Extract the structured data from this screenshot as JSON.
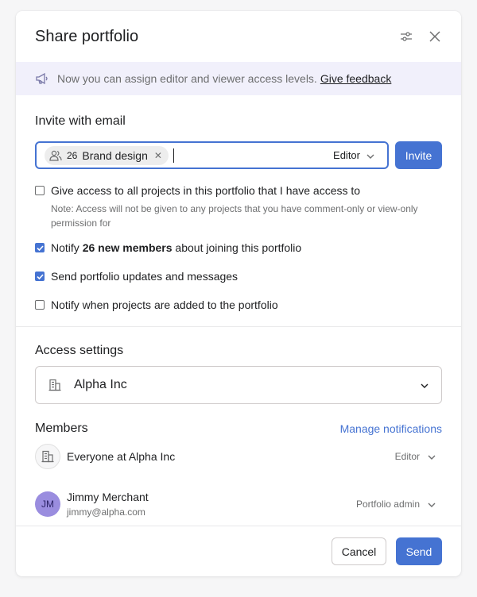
{
  "dialog": {
    "title": "Share portfolio"
  },
  "banner": {
    "message": "Now you can assign editor and viewer access levels.",
    "feedback_link": "Give feedback"
  },
  "invite": {
    "section_title": "Invite with email",
    "chip": {
      "count": "26",
      "name": "Brand design"
    },
    "role": "Editor",
    "invite_button": "Invite"
  },
  "options": [
    {
      "label": "Give access to all projects in this portfolio that I have access to",
      "checked": false
    },
    {
      "label_prefix": "Notify ",
      "label_bold": "26 new members",
      "label_suffix": " about joining this portfolio",
      "checked": true
    },
    {
      "label": "Send portfolio updates and messages",
      "checked": true
    },
    {
      "label": "Notify when projects are added to the portfolio",
      "checked": false
    }
  ],
  "option_note": "Note: Access will not be given to any projects that you have comment-only or view-only permission for",
  "access": {
    "section_title": "Access settings",
    "org": "Alpha Inc"
  },
  "members": {
    "section_title": "Members",
    "manage_link": "Manage notifications",
    "list": [
      {
        "name": "Everyone at Alpha Inc",
        "role": "Editor"
      },
      {
        "name": "Jimmy Merchant",
        "email": "jimmy@alpha.com",
        "initials": "JM",
        "role": "Portfolio admin"
      }
    ]
  },
  "footer": {
    "cancel": "Cancel",
    "send": "Send"
  },
  "colors": {
    "accent": "#4573d2",
    "banner_bg": "#f1f0fb",
    "avatar_jm": "#9a8ddf"
  },
  "icons": [
    "settings-sliders-icon",
    "close-icon",
    "megaphone-icon",
    "people-icon",
    "chevron-down-icon",
    "building-icon",
    "checkmark-icon"
  ]
}
